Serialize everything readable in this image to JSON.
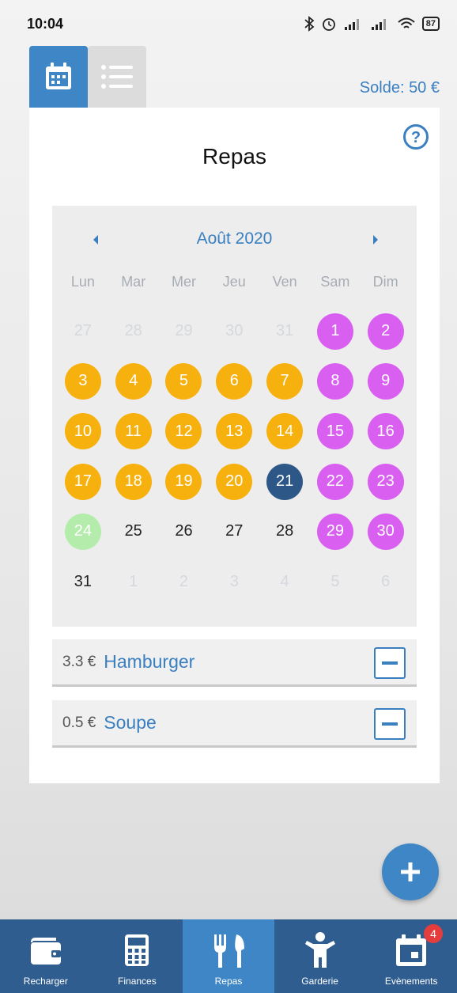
{
  "status": {
    "time": "10:04",
    "battery": "87"
  },
  "header": {
    "solde": "Solde: 50 €"
  },
  "page": {
    "title": "Repas"
  },
  "calendar": {
    "month": "Août 2020",
    "weekdays": [
      "Lun",
      "Mar",
      "Mer",
      "Jeu",
      "Ven",
      "Sam",
      "Dim"
    ],
    "days": [
      {
        "n": "27",
        "s": "muted"
      },
      {
        "n": "28",
        "s": "muted"
      },
      {
        "n": "29",
        "s": "muted"
      },
      {
        "n": "30",
        "s": "muted"
      },
      {
        "n": "31",
        "s": "muted"
      },
      {
        "n": "1",
        "s": "weekend"
      },
      {
        "n": "2",
        "s": "weekend"
      },
      {
        "n": "3",
        "s": "booked"
      },
      {
        "n": "4",
        "s": "booked"
      },
      {
        "n": "5",
        "s": "booked"
      },
      {
        "n": "6",
        "s": "booked"
      },
      {
        "n": "7",
        "s": "booked"
      },
      {
        "n": "8",
        "s": "weekend"
      },
      {
        "n": "9",
        "s": "weekend"
      },
      {
        "n": "10",
        "s": "booked"
      },
      {
        "n": "11",
        "s": "booked"
      },
      {
        "n": "12",
        "s": "booked"
      },
      {
        "n": "13",
        "s": "booked"
      },
      {
        "n": "14",
        "s": "booked"
      },
      {
        "n": "15",
        "s": "weekend"
      },
      {
        "n": "16",
        "s": "weekend"
      },
      {
        "n": "17",
        "s": "booked"
      },
      {
        "n": "18",
        "s": "booked"
      },
      {
        "n": "19",
        "s": "booked"
      },
      {
        "n": "20",
        "s": "booked"
      },
      {
        "n": "21",
        "s": "today"
      },
      {
        "n": "22",
        "s": "weekend"
      },
      {
        "n": "23",
        "s": "weekend"
      },
      {
        "n": "24",
        "s": "light"
      },
      {
        "n": "25",
        "s": "plain"
      },
      {
        "n": "26",
        "s": "plain"
      },
      {
        "n": "27",
        "s": "plain"
      },
      {
        "n": "28",
        "s": "plain"
      },
      {
        "n": "29",
        "s": "weekend"
      },
      {
        "n": "30",
        "s": "weekend"
      },
      {
        "n": "31",
        "s": "plain"
      },
      {
        "n": "1",
        "s": "muted"
      },
      {
        "n": "2",
        "s": "muted"
      },
      {
        "n": "3",
        "s": "muted"
      },
      {
        "n": "4",
        "s": "muted"
      },
      {
        "n": "5",
        "s": "muted"
      },
      {
        "n": "6",
        "s": "muted"
      }
    ]
  },
  "meals": [
    {
      "price": "3.3 €",
      "name": "Hamburger"
    },
    {
      "price": "0.5 €",
      "name": "Soupe"
    }
  ],
  "bottom_nav": {
    "items": [
      {
        "label": "Recharger",
        "icon": "wallet-icon"
      },
      {
        "label": "Finances",
        "icon": "calculator-icon"
      },
      {
        "label": "Repas",
        "icon": "fork-knife-icon"
      },
      {
        "label": "Garderie",
        "icon": "child-icon"
      },
      {
        "label": "Evènements",
        "icon": "calendar-icon"
      }
    ],
    "events_badge": "4"
  },
  "colors": {
    "accent": "#3f86c6",
    "nav_bg": "#2f5d8f",
    "weekend": "#d95ff0",
    "booked": "#f7b10f",
    "today": "#2c5786",
    "light": "#b3ecab"
  }
}
